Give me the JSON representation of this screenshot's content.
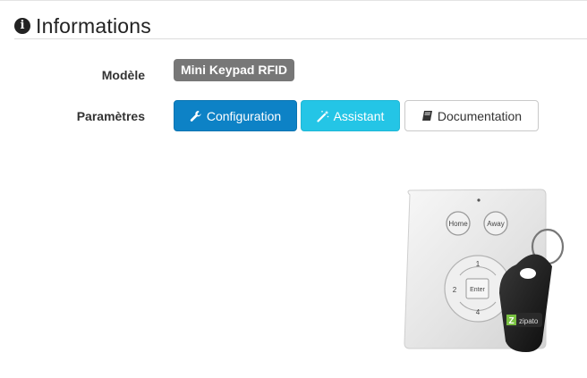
{
  "header": {
    "icon": "info-circle-icon",
    "title": "Informations"
  },
  "fields": {
    "model_label": "Modèle",
    "model_value": "Mini Keypad RFID",
    "params_label": "Paramètres"
  },
  "buttons": {
    "configuration": {
      "label": "Configuration",
      "icon": "wrench-icon",
      "color": "#0d82c6"
    },
    "assistant": {
      "label": "Assistant",
      "icon": "magic-wand-icon",
      "color": "#24c5e6"
    },
    "documentation": {
      "label": "Documentation",
      "icon": "book-icon",
      "color": "#ffffff"
    }
  },
  "device_image": {
    "keys": {
      "home": "Home",
      "away": "Away",
      "one": "1",
      "two": "2",
      "enter": "Enter",
      "four": "4"
    },
    "fob_brand": "zipato"
  }
}
